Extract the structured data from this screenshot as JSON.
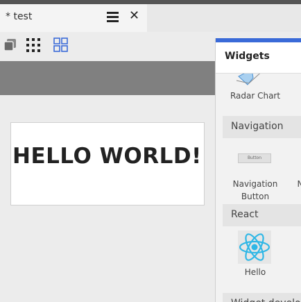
{
  "tab": {
    "title": "* test"
  },
  "panel": {
    "title": "Widgets",
    "accent_color": "#3a6ad8",
    "sections": {
      "navigation": "Navigation",
      "react": "React",
      "widget_dev": "Widget develo"
    },
    "widgets": {
      "radar_chart": "Radar Chart",
      "nav_button_line1": "Navigation",
      "nav_button_line2": "Button",
      "nav_button_preview": "Button",
      "next_cut": "N",
      "hello": "Hello"
    }
  },
  "canvas": {
    "text": "HELLO WORLD!"
  },
  "icons": {
    "menu": "hamburger-menu-icon",
    "close": "close-icon",
    "layers": "layers-icon",
    "grid": "dots-grid-icon",
    "layout": "layout-grid-icon"
  }
}
